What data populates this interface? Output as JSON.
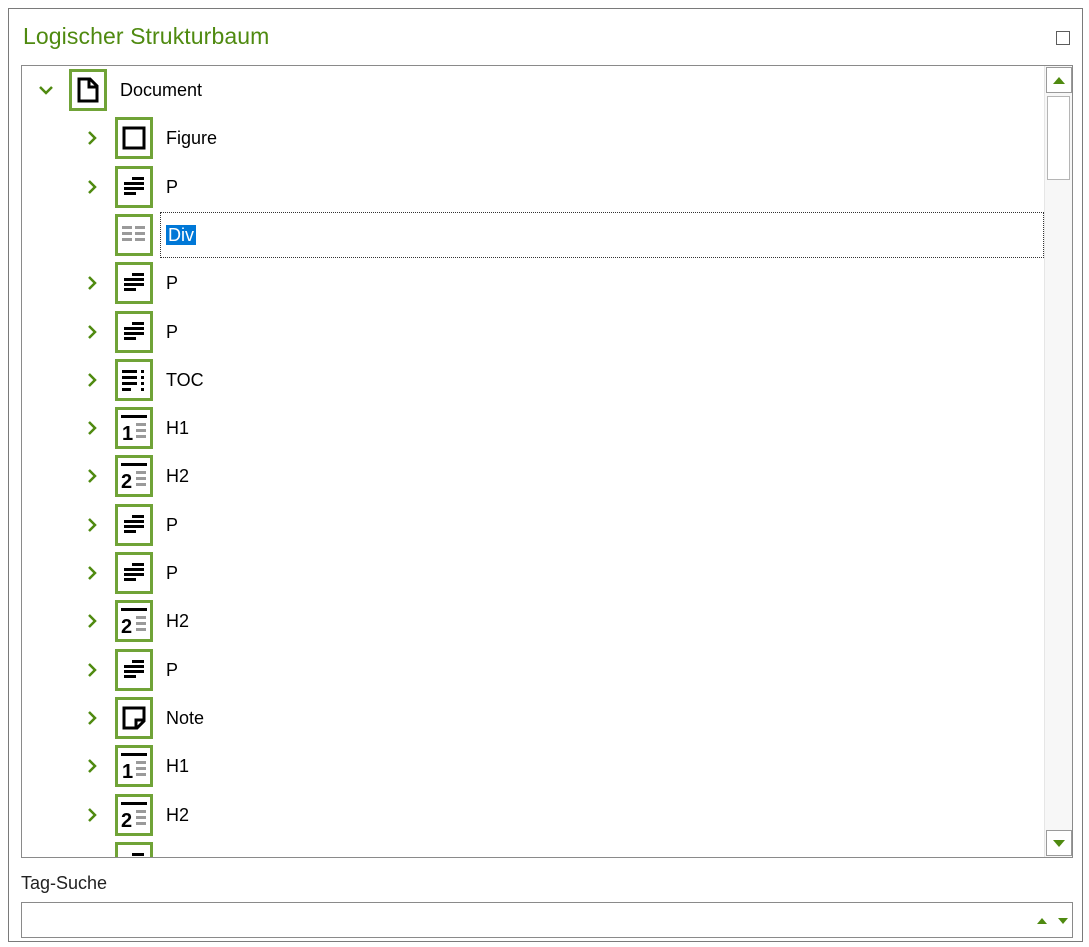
{
  "panel": {
    "title": "Logischer Strukturbaum",
    "maximize_icon": "maximize-icon",
    "accent_color": "#4f8a10",
    "icon_border_color": "#70a337",
    "selection_color": "#0078d7"
  },
  "tree": {
    "root": {
      "label": "Document",
      "icon": "document-icon",
      "expanded": true
    },
    "children": [
      {
        "label": "Figure",
        "icon": "figure-icon",
        "has_children": true
      },
      {
        "label": "P",
        "icon": "paragraph-icon",
        "has_children": true
      },
      {
        "label": "Div",
        "icon": "div-icon",
        "has_children": false,
        "selected": true
      },
      {
        "label": "P",
        "icon": "paragraph-icon",
        "has_children": true
      },
      {
        "label": "P",
        "icon": "paragraph-icon",
        "has_children": true
      },
      {
        "label": "TOC",
        "icon": "toc-icon",
        "has_children": true
      },
      {
        "label": "H1",
        "icon": "heading1-icon",
        "has_children": true
      },
      {
        "label": "H2",
        "icon": "heading2-icon",
        "has_children": true
      },
      {
        "label": "P",
        "icon": "paragraph-icon",
        "has_children": true
      },
      {
        "label": "P",
        "icon": "paragraph-icon",
        "has_children": true
      },
      {
        "label": "H2",
        "icon": "heading2-icon",
        "has_children": true
      },
      {
        "label": "P",
        "icon": "paragraph-icon",
        "has_children": true
      },
      {
        "label": "Note",
        "icon": "note-icon",
        "has_children": true
      },
      {
        "label": "H1",
        "icon": "heading1-icon",
        "has_children": true
      },
      {
        "label": "H2",
        "icon": "heading2-icon",
        "has_children": true
      },
      {
        "label": "",
        "icon": "paragraph-icon",
        "has_children": false
      }
    ]
  },
  "search": {
    "label": "Tag-Suche",
    "value": "",
    "placeholder": ""
  }
}
